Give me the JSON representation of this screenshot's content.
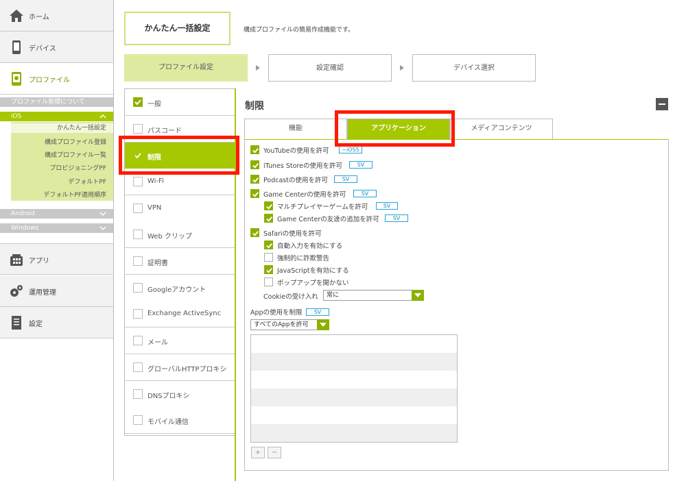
{
  "sidebar": {
    "nav": [
      {
        "label": "ホーム",
        "icon": "home-icon"
      },
      {
        "label": "デバイス",
        "icon": "smartphone-icon"
      },
      {
        "label": "プロファイル",
        "icon": "profile-icon"
      }
    ],
    "profile_about": "プロファイル管理について",
    "ios_label": "iOS",
    "ios_items": [
      "かんたん一括設定",
      "構成プロファイル登録",
      "構成プロファイル一覧",
      "プロビジョニングPF",
      "デフォルトPF",
      "デフォルトPF適用順序"
    ],
    "android_label": "Android",
    "windows_label": "Windows",
    "bottom_nav": [
      {
        "label": "アプリ",
        "icon": "app-icon"
      },
      {
        "label": "運用管理",
        "icon": "gears-icon"
      },
      {
        "label": "設定",
        "icon": "settings-doc-icon"
      }
    ]
  },
  "header": {
    "title": "かんたん一括設定",
    "description": "構成プロファイルの簡易作成機能です。",
    "steps": [
      "プロファイル設定",
      "設定確認",
      "デバイス選択"
    ]
  },
  "categories": [
    {
      "label": "一般",
      "checked": true
    },
    {
      "label": "パスコード",
      "checked": false
    },
    {
      "label": "制限",
      "checked": true,
      "active": true
    },
    {
      "label": "Wi-Fi",
      "checked": false
    },
    {
      "label": "VPN",
      "checked": false
    },
    {
      "label": "Web クリップ",
      "checked": false
    },
    {
      "label": "証明書",
      "checked": false
    },
    {
      "label": "Googleアカウント",
      "checked": false
    },
    {
      "label": "Exchange ActiveSync",
      "checked": false
    },
    {
      "label": "メール",
      "checked": false
    },
    {
      "label": "グローバルHTTPプロキシ",
      "checked": false
    },
    {
      "label": "DNSプロキシ",
      "checked": false
    },
    {
      "label": "モバイル通信",
      "checked": false
    }
  ],
  "main": {
    "section_title": "制限",
    "tabs": [
      "機能",
      "アプリケーション",
      "メディアコンテンツ"
    ],
    "options": [
      {
        "label": "YouTubeの使用を許可",
        "checked": true,
        "badge": "~iOS5"
      },
      {
        "label": "iTunes Storeの使用を許可",
        "checked": true,
        "badge": "SV"
      },
      {
        "label": "Podcastの使用を許可",
        "checked": true,
        "badge": "SV"
      },
      {
        "label": "Game Centerの使用を許可",
        "checked": true,
        "badge": "SV"
      },
      {
        "label": "マルチプレイヤーゲームを許可",
        "checked": true,
        "badge": "SV"
      },
      {
        "label": "Game Centerの友達の追加を許可",
        "checked": true,
        "badge": "SV"
      },
      {
        "label": "Safariの使用を許可",
        "checked": true
      },
      {
        "label": "自動入力を有効にする",
        "checked": true
      },
      {
        "label": "強制的に詐欺警告",
        "checked": false
      },
      {
        "label": "JavaScriptを有効にする",
        "checked": true
      },
      {
        "label": "ポップアップを開かない",
        "checked": false
      }
    ],
    "cookie_label": "Cookieの受け入れ",
    "cookie_value": "常に",
    "app_usage_label": "Appの使用を制限",
    "app_usage_badge": "SV",
    "app_usage_value": "すべてのAppを許可",
    "add_btn": "+",
    "remove_btn": "−"
  },
  "colors": {
    "accent": "#a6c800",
    "highlight": "#ff1a00",
    "badge": "#22a4d6"
  }
}
